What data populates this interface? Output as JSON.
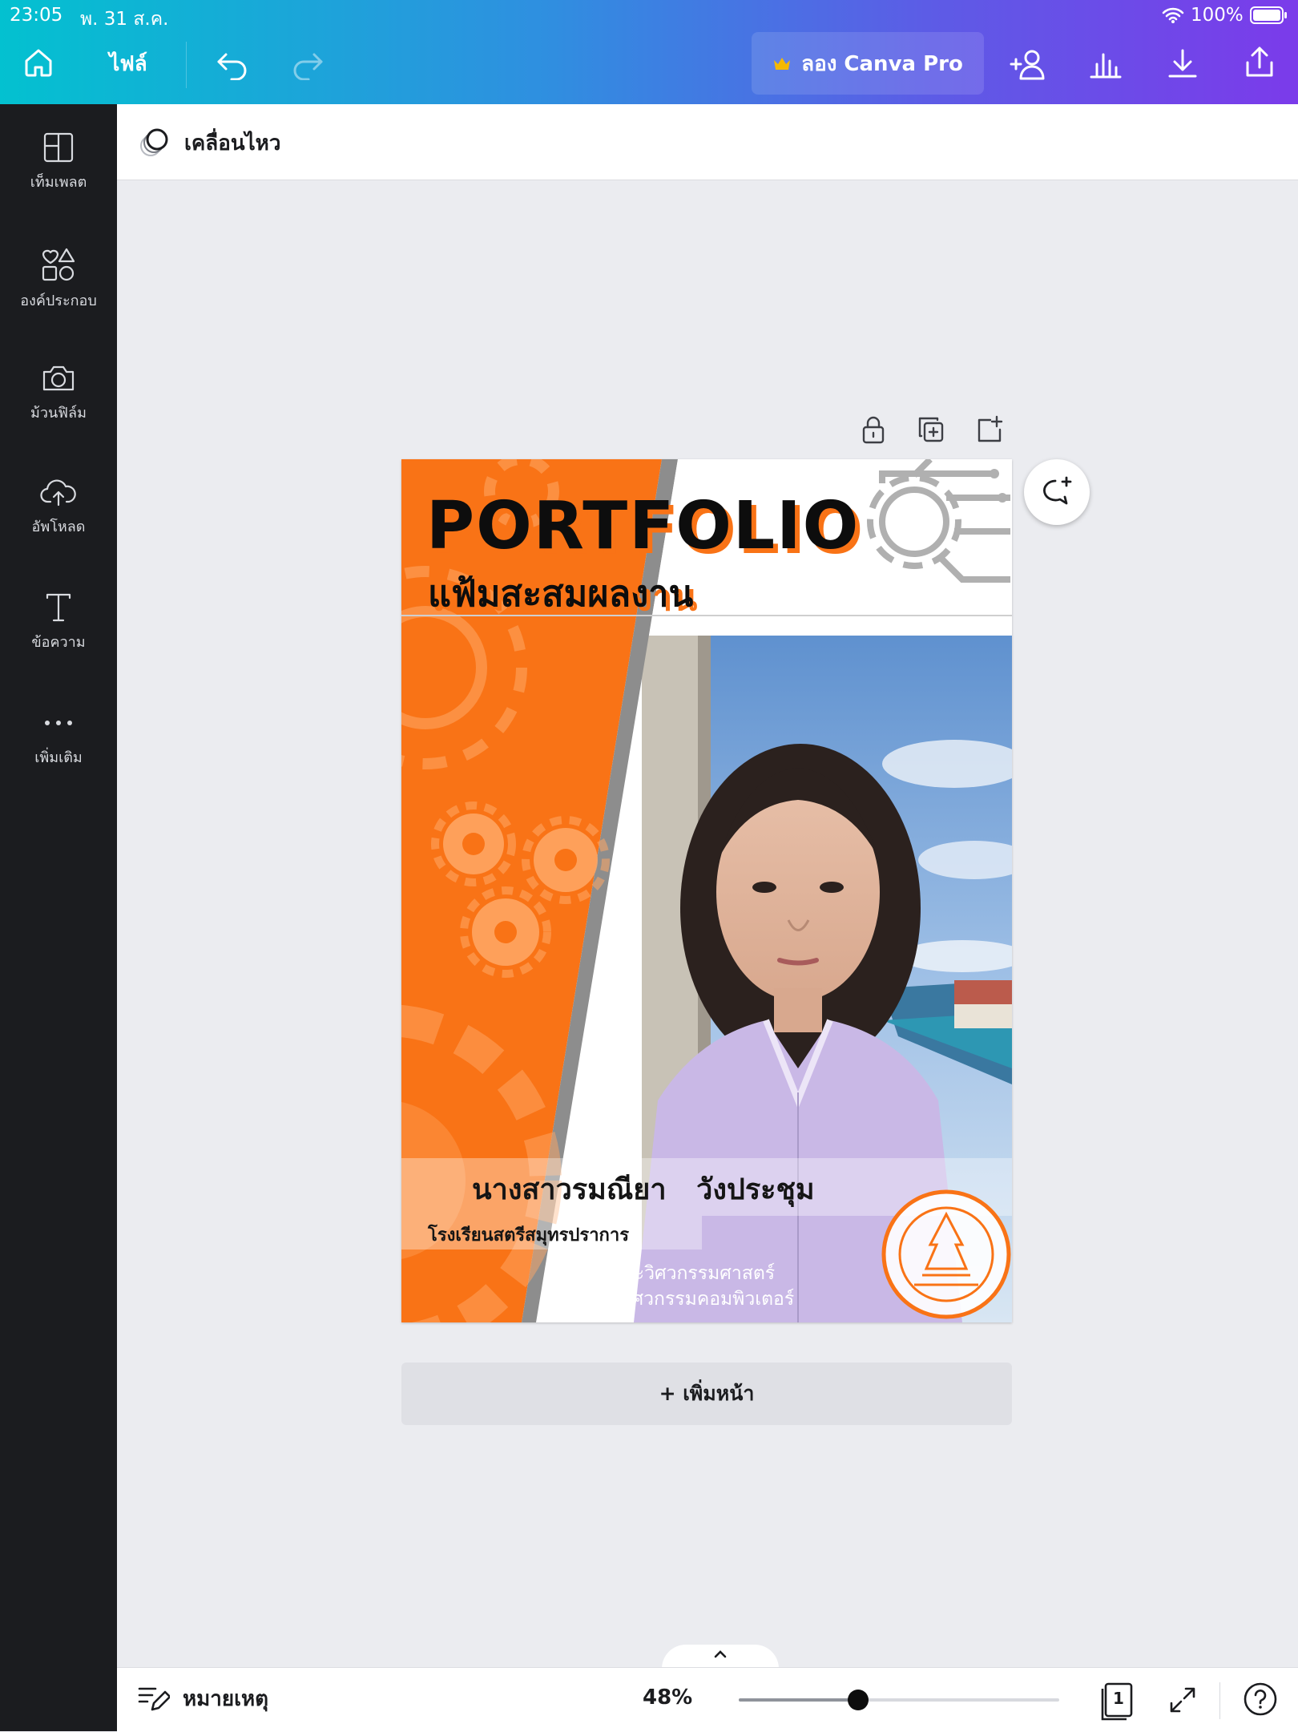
{
  "status_bar": {
    "time": "23:05",
    "date": "พ. 31 ส.ค.",
    "battery": "100%"
  },
  "toolbar": {
    "file_label": "ไฟล์",
    "pro_label": "ลอง Canva Pro"
  },
  "sidebar": {
    "items": [
      {
        "label": "เท็มเพลต",
        "icon": "template-icon"
      },
      {
        "label": "องค์ประกอบ",
        "icon": "elements-icon"
      },
      {
        "label": "ม้วนฟิล์ม",
        "icon": "camera-icon"
      },
      {
        "label": "อัพโหลด",
        "icon": "upload-cloud-icon"
      },
      {
        "label": "ข้อความ",
        "icon": "text-icon"
      },
      {
        "label": "เพิ่มเติม",
        "icon": "more-icon"
      }
    ]
  },
  "options_bar": {
    "animate_label": "เคลื่อนไหว"
  },
  "design": {
    "title": "PORTFOLIO",
    "subtitle": "แฟ้มสะสมผลงาน",
    "name": "นางสาวรมณียา   วังประชุม",
    "school": "โรงเรียนสตรีสมุทรปราการ",
    "faculty": "คณะวิศวกรรมศาสตร์",
    "major": "สาขาวิศวกรรมคอมพิวเตอร์",
    "accent_color": "#f97316"
  },
  "add_page_label": "+ เพิ่มหน้า",
  "bottom_bar": {
    "notes_label": "หมายเหตุ",
    "zoom": "48%",
    "zoom_fraction": 0.48,
    "page_count": "1"
  }
}
